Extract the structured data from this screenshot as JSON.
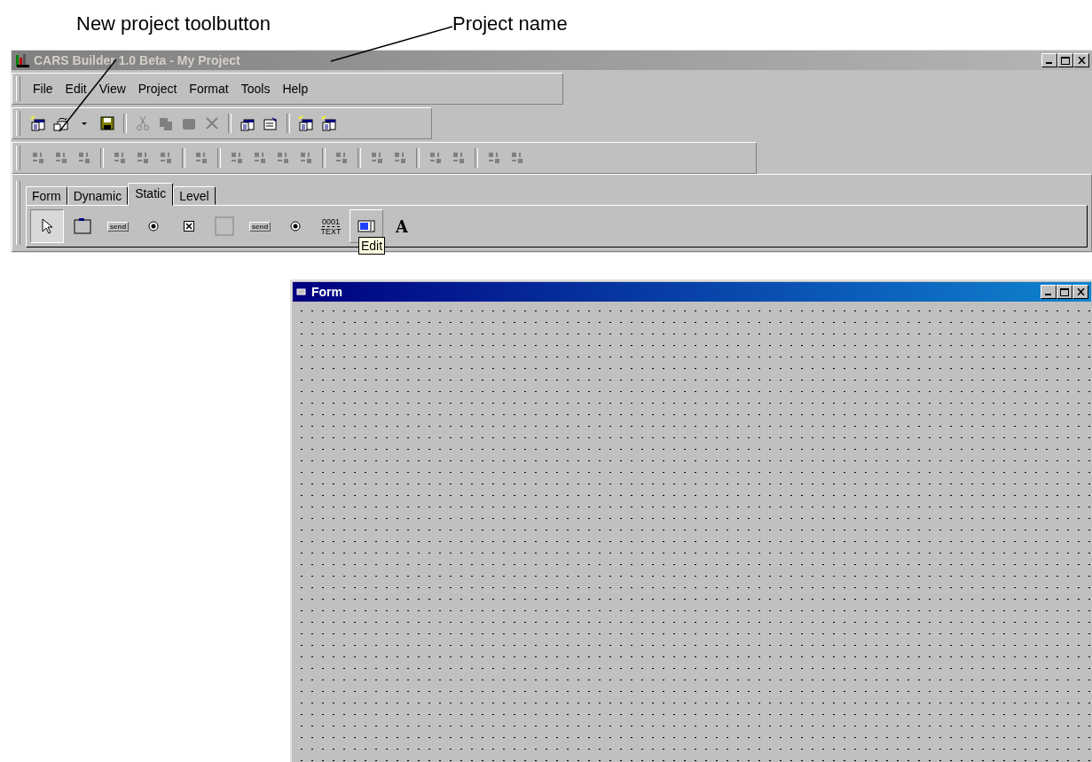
{
  "annotations": [
    {
      "text": "New project toolbutton"
    },
    {
      "text": "Project name"
    }
  ],
  "window": {
    "title": "CARS Builder 1.0 Beta - My Project",
    "active": false
  },
  "menu": [
    {
      "label": "File"
    },
    {
      "label": "Edit"
    },
    {
      "label": "View"
    },
    {
      "label": "Project"
    },
    {
      "label": "Format"
    },
    {
      "label": "Tools"
    },
    {
      "label": "Help"
    }
  ],
  "toolbar": [
    {
      "kind": "new-project",
      "disabled": false
    },
    {
      "kind": "open",
      "disabled": false
    },
    {
      "kind": "dropdown",
      "disabled": false
    },
    {
      "kind": "save",
      "disabled": false
    },
    {
      "kind": "separator"
    },
    {
      "kind": "cut",
      "disabled": true
    },
    {
      "kind": "copy",
      "disabled": true
    },
    {
      "kind": "paste",
      "disabled": true
    },
    {
      "kind": "delete",
      "disabled": true
    },
    {
      "kind": "separator"
    },
    {
      "kind": "windows",
      "disabled": false
    },
    {
      "kind": "properties",
      "disabled": false
    },
    {
      "kind": "separator"
    },
    {
      "kind": "new-form",
      "disabled": false
    },
    {
      "kind": "new-grid",
      "disabled": false
    }
  ],
  "align_toolbar": [
    {
      "kind": "align",
      "disabled": true
    },
    {
      "kind": "align",
      "disabled": true
    },
    {
      "kind": "align",
      "disabled": true
    },
    {
      "kind": "separator"
    },
    {
      "kind": "align",
      "disabled": true
    },
    {
      "kind": "align",
      "disabled": true
    },
    {
      "kind": "align",
      "disabled": true
    },
    {
      "kind": "separator"
    },
    {
      "kind": "align",
      "disabled": true
    },
    {
      "kind": "separator"
    },
    {
      "kind": "align",
      "disabled": true
    },
    {
      "kind": "align",
      "disabled": true
    },
    {
      "kind": "align",
      "disabled": true
    },
    {
      "kind": "align",
      "disabled": true
    },
    {
      "kind": "separator"
    },
    {
      "kind": "align",
      "disabled": true
    },
    {
      "kind": "separator"
    },
    {
      "kind": "align",
      "disabled": true
    },
    {
      "kind": "align",
      "disabled": true
    },
    {
      "kind": "separator"
    },
    {
      "kind": "align",
      "disabled": true
    },
    {
      "kind": "align",
      "disabled": true
    },
    {
      "kind": "separator"
    },
    {
      "kind": "align",
      "disabled": true
    },
    {
      "kind": "align",
      "disabled": true
    }
  ],
  "palette": {
    "tabs": [
      {
        "label": "Form",
        "selected": false
      },
      {
        "label": "Dynamic",
        "selected": false
      },
      {
        "label": "Static",
        "selected": true
      },
      {
        "label": "Level",
        "selected": false
      }
    ],
    "tools": [
      {
        "kind": "pointer",
        "selected": true,
        "hovered": false
      },
      {
        "kind": "frame",
        "selected": false,
        "hovered": false
      },
      {
        "kind": "button",
        "text": "send",
        "selected": false,
        "hovered": false
      },
      {
        "kind": "radio",
        "selected": false,
        "hovered": false
      },
      {
        "kind": "checkbox",
        "selected": false,
        "hovered": false
      },
      {
        "kind": "panel",
        "selected": false,
        "hovered": false
      },
      {
        "kind": "button",
        "text": "send",
        "selected": false,
        "hovered": false
      },
      {
        "kind": "radio",
        "selected": false,
        "hovered": false
      },
      {
        "kind": "counter",
        "text": "0001",
        "caption": "TEXT",
        "selected": false,
        "hovered": false
      },
      {
        "kind": "edit",
        "selected": false,
        "hovered": true
      },
      {
        "kind": "label",
        "text": "A",
        "selected": false,
        "hovered": false
      }
    ],
    "tooltip": {
      "text": "Edit"
    }
  },
  "form_window": {
    "title": "Form",
    "active": true
  }
}
